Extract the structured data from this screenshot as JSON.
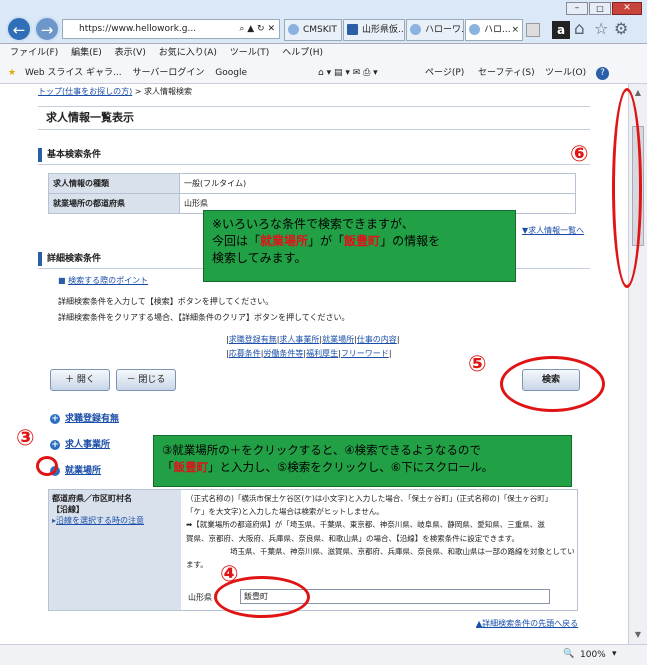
{
  "browser": {
    "url": "https://www.hellowork.g...",
    "tabs": [
      "CMSKIT",
      "山形県仮...",
      "ハローワ...",
      "ハロ..."
    ],
    "menu": [
      "ファイル(F)",
      "編集(E)",
      "表示(V)",
      "お気に入り(A)",
      "ツール(T)",
      "ヘルプ(H)"
    ],
    "fav_items": [
      "Web スライス ギャラ...",
      "サーバーログイン",
      "Google"
    ],
    "toolbar_items": [
      "ページ(P)",
      "セーフティ(S)",
      "ツール(O)"
    ],
    "zoom": "100%"
  },
  "page": {
    "breadcrumb_link": "トップ(仕事をお探しの方)",
    "breadcrumb_current": "> 求人情報検索",
    "title": "求人情報一覧表示",
    "basic": {
      "heading": "基本検索条件",
      "rows": [
        {
          "label": "求人情報の種類",
          "value": "一般(フルタイム)"
        },
        {
          "label": "就業場所の都道府県",
          "value": "山形県"
        }
      ],
      "list_link": "▼求人情報一覧へ"
    },
    "detail": {
      "heading": "詳細検索条件",
      "tips_link": "検索する際のポイント",
      "instr1": "詳細検索条件を入力して【検索】ボタンを押してください。",
      "instr2": "詳細検索条件をクリアする場合、【詳細条件のクリア】ボタンを押してください。",
      "jump_links_row1": [
        "求職登録有無",
        "求人事業所",
        "就業場所",
        "仕事の内容"
      ],
      "jump_links_row2": [
        "応募条件",
        "労働条件等",
        "福利厚生",
        "フリーワード"
      ],
      "open_button": "＋ 開く",
      "close_button": "－ 閉じる",
      "search_button": "検索",
      "sections": [
        "求職登録有無",
        "求人事業所",
        "就業場所"
      ],
      "pref_label1": "都道府県／市区町村名",
      "pref_label2": "【沿線】",
      "route_note_link": "沿線を選択する時の注意",
      "text1": "（正式名称の)「横浜市保土ケ谷区(ケ)は小文字)と入力した場合、「保土ヶ谷町」(正式名称の)「保土ヶ谷町」",
      "text2": "「ケ」を大文字)と入力した場合は検索がヒットしません。",
      "text3": "➡【就業場所の都道府県】が「埼玉県、千葉県、東京都、神奈川県、岐阜県、静岡県、愛知県、三重県、滋",
      "text4": "賀県、京都府、大阪府、兵庫県、奈良県、和歌山県」の場合、【沿線】を検索条件に設定できます。",
      "text5": "埼玉県、千葉県、神奈川県、滋賀県、京都府、兵庫県、奈良県、和歌山県は一部の路線を対象としてい",
      "text6": "ます。",
      "pref_prefix": "山形県",
      "city_input": "飯豊町",
      "back_to_top": "▲詳細検索条件の先頭へ戻る"
    }
  },
  "annotations": {
    "note1_line1": "※いろいろな条件で検索できますが、",
    "note1_line2_a": "今回は「",
    "note1_line2_b": "就業場所",
    "note1_line2_c": "」が「",
    "note1_line2_d": "飯豊町",
    "note1_line2_e": "」の情報を",
    "note1_line3": "検索してみます。",
    "note2_line1": "③就業場所の＋をクリックすると、④検索できるようなるので",
    "note2_line2_a": "「",
    "note2_line2_b": "飯豊町",
    "note2_line2_c": "」と入力し、⑤検索をクリックし、⑥下にスクロール。",
    "n3": "③",
    "n4": "④",
    "n5": "⑤",
    "n6": "⑥"
  }
}
